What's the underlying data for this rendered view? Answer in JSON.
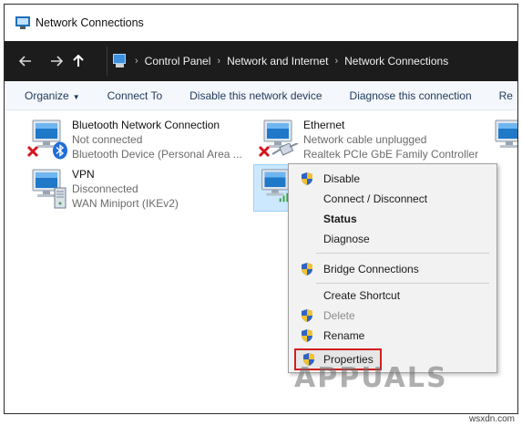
{
  "window": {
    "title": "Network Connections"
  },
  "address": {
    "breadcrumbs": [
      "Control Panel",
      "Network and Internet",
      "Network Connections"
    ],
    "nav_icons": [
      "back-arrow-icon",
      "forward-arrow-icon",
      "up-arrow-icon"
    ]
  },
  "toolbar": {
    "organize": "Organize",
    "connect_to": "Connect To",
    "disable_device": "Disable this network device",
    "diagnose": "Diagnose this connection",
    "rename_partial": "Re"
  },
  "connections": [
    {
      "name": "Bluetooth Network Connection",
      "status": "Not connected",
      "device": "Bluetooth Device (Personal Area ...",
      "icon": "network-computer-icon",
      "overlay": "red-x-icon",
      "badge": "bluetooth-icon"
    },
    {
      "name": "Ethernet",
      "status": "Network cable unplugged",
      "device": "Realtek PCIe GbE Family Controller",
      "icon": "network-computer-icon",
      "overlay": "red-x-icon",
      "badge": "ethernet-cable-icon"
    },
    {
      "name": "VPN",
      "status": "Disconnected",
      "device": "WAN Miniport (IKEv2)",
      "icon": "network-computer-icon",
      "badge": "vpn-server-icon"
    }
  ],
  "context_menu": {
    "items": [
      {
        "label": "Disable",
        "shield": true
      },
      {
        "label": "Connect / Disconnect",
        "shield": false
      },
      {
        "label": "Status",
        "shield": false,
        "bold": true
      },
      {
        "label": "Diagnose",
        "shield": false
      },
      {
        "label": "Bridge Connections",
        "shield": true
      },
      {
        "label": "Create Shortcut",
        "shield": false
      },
      {
        "label": "Delete",
        "shield": true,
        "disabled": true
      },
      {
        "label": "Rename",
        "shield": true
      },
      {
        "label": "Properties",
        "shield": true,
        "highlighted": true
      }
    ]
  },
  "watermarks": {
    "brand": "APPUALS",
    "site": "wsxdn.com"
  },
  "colors": {
    "title_bar": "#ffffff",
    "address_bar": "#1c1c1c",
    "command_bar": "#f4f7fb",
    "command_text": "#1e395b",
    "selection": "#cce8ff",
    "highlight_border": "#d11f1f",
    "shield_blue": "#2f63c4",
    "shield_gold": "#f2c230"
  }
}
